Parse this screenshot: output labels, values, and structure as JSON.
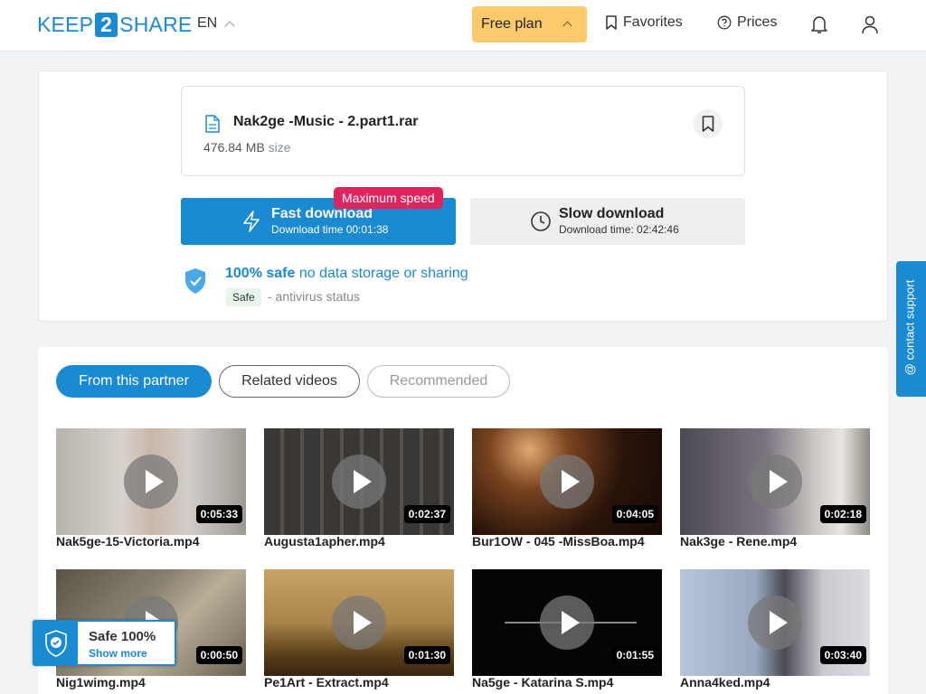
{
  "header": {
    "logo_left": "KEEP",
    "logo_mid": "2",
    "logo_right": "SHARE",
    "lang": "EN",
    "plan": "Free plan",
    "favorites": "Favorites",
    "prices": "Prices"
  },
  "file": {
    "name": "Nak2ge -Music - 2.part1.rar",
    "size": "476.84 MB",
    "size_unit": "size"
  },
  "download": {
    "badge": "Maximum speed",
    "fast_title": "Fast download",
    "fast_sub": "Download time 00:01:38",
    "slow_title": "Slow download",
    "slow_sub": "Download time: 02:42:46"
  },
  "safety": {
    "strong": "100% safe",
    "rest": "no data storage or sharing",
    "badge": "Safe",
    "status": "- antivirus status"
  },
  "tabs": [
    "From this partner",
    "Related videos",
    "Recommended"
  ],
  "videos": [
    {
      "title": "Nak5ge-15-Victoria.mp4",
      "duration": "0:05:33"
    },
    {
      "title": "Augusta1apher.mp4",
      "duration": "0:02:37"
    },
    {
      "title": "Bur1OW - 045 -MissBoa.mp4",
      "duration": "0:04:05"
    },
    {
      "title": "Nak3ge - Rene.mp4",
      "duration": "0:02:18"
    },
    {
      "title": "Nig1wimg.mp4",
      "duration": "0:00:50"
    },
    {
      "title": "Pe1Art - Extract.mp4",
      "duration": "0:01:30"
    },
    {
      "title": "Na5ge - Katarina S.mp4",
      "duration": "0:01:55"
    },
    {
      "title": "Anna4ked.mp4",
      "duration": "0:03:40"
    }
  ],
  "support": "contact support",
  "safe_widget": {
    "title": "Safe 100%",
    "link": "Show more"
  },
  "colors": {
    "accent": "#1a8ad3",
    "plan": "#fcc96b",
    "badge": "#e0245e"
  }
}
